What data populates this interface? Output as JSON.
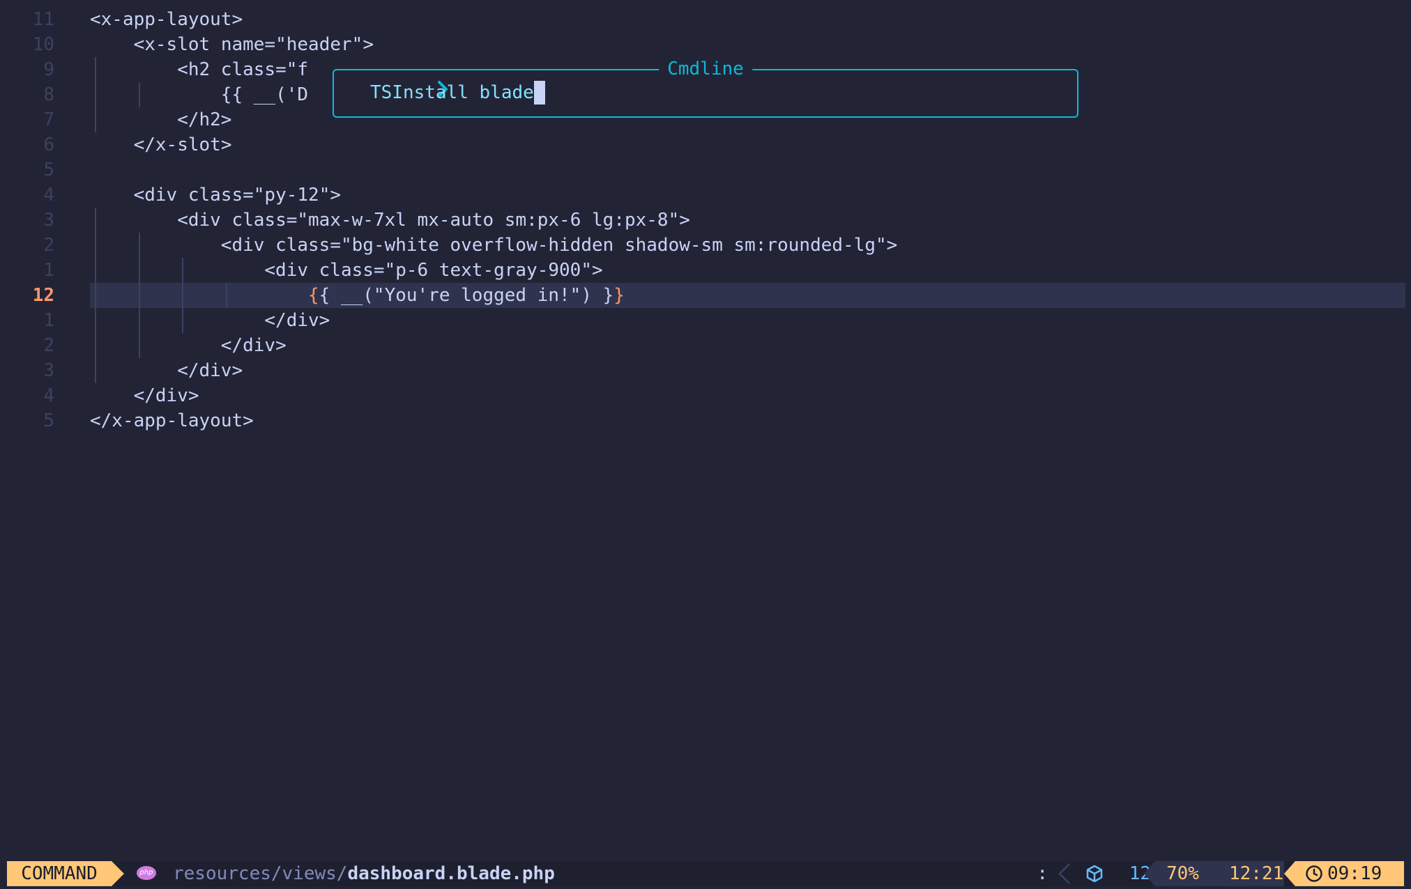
{
  "editor": {
    "lines": [
      {
        "num": "11",
        "text": "<x-app-layout>",
        "indent": 0,
        "current": false
      },
      {
        "num": "10",
        "text": "<x-slot name=\"header\">",
        "indent": 1,
        "current": false
      },
      {
        "num": "9",
        "text": "<h2 class=\"f",
        "indent": 2,
        "current": false
      },
      {
        "num": "8",
        "text": "{{ __('D",
        "indent": 3,
        "current": false
      },
      {
        "num": "7",
        "text": "</h2>",
        "indent": 2,
        "current": false
      },
      {
        "num": "6",
        "text": "</x-slot>",
        "indent": 1,
        "current": false
      },
      {
        "num": "5",
        "text": "",
        "indent": 0,
        "current": false
      },
      {
        "num": "4",
        "text": "<div class=\"py-12\">",
        "indent": 1,
        "current": false
      },
      {
        "num": "3",
        "text": "<div class=\"max-w-7xl mx-auto sm:px-6 lg:px-8\">",
        "indent": 2,
        "current": false
      },
      {
        "num": "2",
        "text": "<div class=\"bg-white overflow-hidden shadow-sm sm:rounded-lg\">",
        "indent": 3,
        "current": false
      },
      {
        "num": "1",
        "text": "<div class=\"p-6 text-gray-900\">",
        "indent": 4,
        "current": false
      },
      {
        "num": "12",
        "text": "{ __(\"You're logged in!\") }",
        "indent": 5,
        "current": true,
        "brace_open": "{",
        "brace_close": "}"
      },
      {
        "num": "1",
        "text": "</div>",
        "indent": 4,
        "current": false
      },
      {
        "num": "2",
        "text": "</div>",
        "indent": 3,
        "current": false
      },
      {
        "num": "3",
        "text": "</div>",
        "indent": 2,
        "current": false
      },
      {
        "num": "4",
        "text": "</div>",
        "indent": 1,
        "current": false
      },
      {
        "num": "5",
        "text": "</x-app-layout>",
        "indent": 0,
        "current": false
      }
    ]
  },
  "cmdline": {
    "title": "Cmdline",
    "prompt_icon": "chevron-right-icon",
    "text": "TSInstall blade"
  },
  "statusline": {
    "mode": "COMMAND",
    "filetype_icon": "php-icon",
    "filetype_icon_text": "php",
    "path_dir": "resources/views/",
    "path_file": "dashboard.blade.php",
    "separator": ":",
    "lsp_icon": "cube-icon",
    "lsp_count": "12",
    "percent": "70%",
    "position": "12:21",
    "clock_icon": "clock-icon",
    "time": "09:19"
  },
  "colors": {
    "background": "#222436",
    "accent": "#0db9d7",
    "mode_bg": "#ffc777",
    "current_line_number": "#ff966c"
  }
}
